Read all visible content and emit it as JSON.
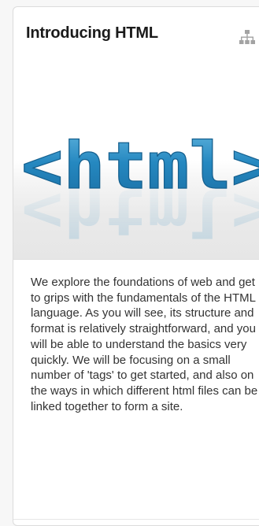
{
  "card": {
    "title": "Introducing HTML",
    "title_icon": "sitemap-icon",
    "image": {
      "icon": "html-tag-logo",
      "text": "<html>",
      "accent_color": "#1f8fc8"
    },
    "description": "We explore the foundations of web and get to grips with the fundamentals of the HTML language. As you will see, its structure and format is relatively straightforward, and you will be able to understand the basics very quickly. We will be focusing on a small number of 'tags' to get started, and also on the ways in which different html files can be linked together to form a site."
  }
}
